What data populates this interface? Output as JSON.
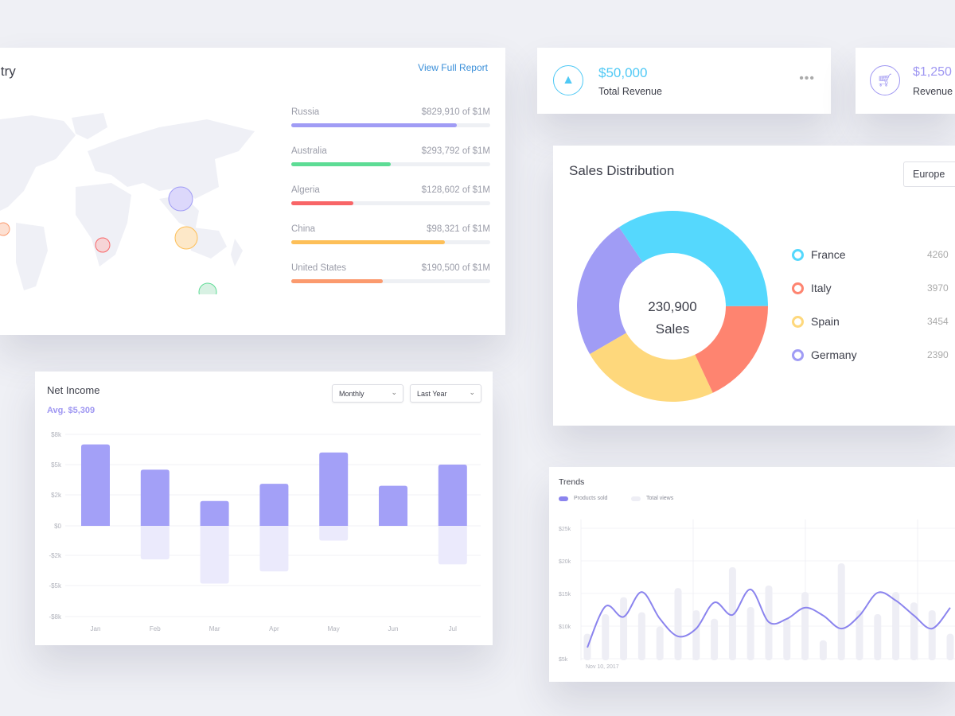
{
  "country_card": {
    "title": "untry",
    "link": "View Full Report",
    "rows": [
      {
        "country": "Russia",
        "value": "$829,910 of $1M",
        "fill_pct": 83,
        "color": "#a09cf5"
      },
      {
        "country": "Australia",
        "value": "$293,792 of $1M",
        "fill_pct": 50,
        "color": "#5ddc95"
      },
      {
        "country": "Algeria",
        "value": "$128,602 of $1M",
        "fill_pct": 31,
        "color": "#f86567"
      },
      {
        "country": "China",
        "value": "$98,321 of $1M",
        "fill_pct": 77,
        "color": "#fdbf58"
      },
      {
        "country": "United States",
        "value": "$190,500 of $1M",
        "fill_pct": 46,
        "color": "#fb9a6e"
      }
    ]
  },
  "stats": [
    {
      "value": "$50,000",
      "label": "Total Revenue",
      "icon": "money-bag-icon",
      "color": "#4fc9f5",
      "menu": "•••"
    },
    {
      "value": "$1,250",
      "label": "Revenue",
      "icon": "cart-icon",
      "color": "#9f97f2"
    }
  ],
  "sales": {
    "title": "Sales Distribution",
    "select": "Europe",
    "center_value": "230,900",
    "center_label": "Sales",
    "legend": [
      {
        "name": "France",
        "value": "4260",
        "color": "#55d8fd"
      },
      {
        "name": "Italy",
        "value": "3970",
        "color": "#fe8470"
      },
      {
        "name": "Spain",
        "value": "3454",
        "color": "#fed87c"
      },
      {
        "name": "Germany",
        "value": "2390",
        "color": "#a09cf5"
      }
    ]
  },
  "net_income": {
    "title": "Net Income",
    "avg": "Avg. $5,309",
    "period": "Monthly",
    "range": "Last Year"
  },
  "trends": {
    "title": "Trends",
    "legend": [
      {
        "name": "Products sold",
        "color": "#8b84ee"
      },
      {
        "name": "Total views",
        "color": "#eeeef5"
      }
    ]
  },
  "chart_data": [
    {
      "type": "pie",
      "title": "Sales Distribution",
      "categories": [
        "France",
        "Italy",
        "Spain",
        "Germany"
      ],
      "share_pct": [
        34.4,
        18.1,
        23.6,
        23.9
      ],
      "colors": [
        "#55d8fd",
        "#fe8470",
        "#fed87c",
        "#a09cf5"
      ]
    },
    {
      "type": "bar",
      "title": "Net Income",
      "categories": [
        "Jan",
        "Feb",
        "Mar",
        "Apr",
        "May",
        "Jun",
        "Jul"
      ],
      "yticks": [
        "$8k",
        "$5k",
        "$2k",
        "$0",
        "-$2k",
        "-$5k",
        "-$8k"
      ],
      "ytick_values": [
        8,
        5,
        2,
        0,
        -2,
        -5,
        -8
      ],
      "series": [
        {
          "values": [
            7.0,
            4.5,
            1.6,
            3.1,
            6.2,
            2.9,
            5.0
          ],
          "color": "#a3a0f7"
        },
        {
          "values": [
            0,
            -2.4,
            -4.8,
            -3.6,
            -1.0,
            0,
            -2.9
          ],
          "color": "#ebeafc"
        }
      ],
      "grid": true
    },
    {
      "type": "line",
      "title": "Trends",
      "yticks": [
        "$25k",
        "$20k",
        "$15k",
        "$10k",
        "$5k"
      ],
      "ylim": [
        5,
        25
      ],
      "xlabel_first": "Nov 10, 2017",
      "series": [
        {
          "name": "Products sold",
          "type": "line",
          "values": [
            6.6,
            12.9,
            11.3,
            15.1,
            11.0,
            8.3,
            9.5,
            13.5,
            11.6,
            15.5,
            10.5,
            11.0,
            12.7,
            11.5,
            9.5,
            11.5,
            15.0,
            13.8,
            11.5,
            9.5,
            12.7
          ]
        },
        {
          "name": "Total views",
          "type": "bar",
          "values": [
            8.7,
            11.7,
            14.3,
            12.0,
            9.8,
            15.7,
            12.3,
            11.0,
            18.9,
            12.8,
            16.1,
            11.0,
            15.1,
            7.7,
            19.5,
            12.3,
            11.7,
            15.1,
            13.5,
            12.3,
            8.7
          ]
        }
      ],
      "grid": true
    }
  ]
}
